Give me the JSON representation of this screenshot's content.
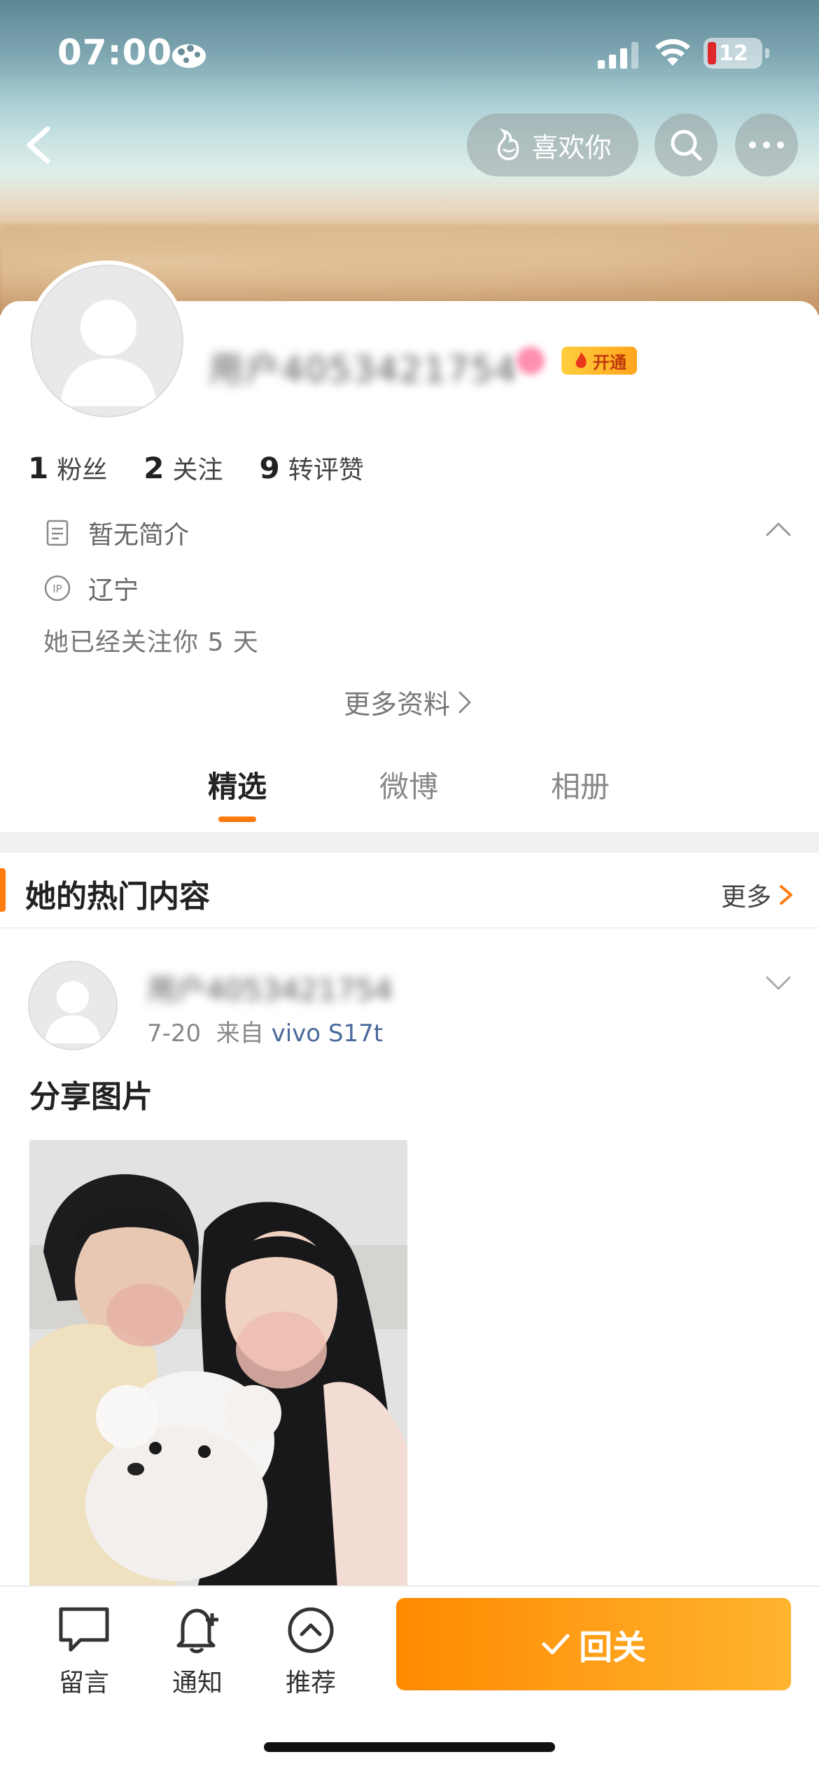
{
  "status_bar": {
    "time": "07:00",
    "battery": "12"
  },
  "nav": {
    "like_label": "喜欢你"
  },
  "profile": {
    "username": "用户4053421754",
    "vip_label": "开通",
    "stats": [
      {
        "num": "1",
        "label": "粉丝"
      },
      {
        "num": "2",
        "label": "关注"
      },
      {
        "num": "9",
        "label": "转评赞"
      }
    ],
    "bio": "暂无简介",
    "ip_badge": "IP",
    "ip_location": "辽宁",
    "follow_note": "她已经关注你 5 天",
    "more_info": "更多资料"
  },
  "tabs": [
    {
      "label": "精选",
      "active": true
    },
    {
      "label": "微博",
      "active": false
    },
    {
      "label": "相册",
      "active": false
    }
  ],
  "section": {
    "title": "她的热门内容",
    "more": "更多"
  },
  "post": {
    "username": "用户4053421754",
    "date": "7-20",
    "source_prefix": "来自",
    "device": "vivo S17t",
    "text": "分享图片"
  },
  "bottom_bar": {
    "items": [
      {
        "label": "留言",
        "icon": "message-icon"
      },
      {
        "label": "通知",
        "icon": "bell-plus-icon"
      },
      {
        "label": "推荐",
        "icon": "chevron-up-circle-icon"
      }
    ],
    "follow_back": "回关"
  },
  "colors": {
    "accent": "#ff7a0f",
    "button_gradient_start": "#ff8a00",
    "button_gradient_end": "#ffb430",
    "device_link": "#4a6a9b"
  }
}
